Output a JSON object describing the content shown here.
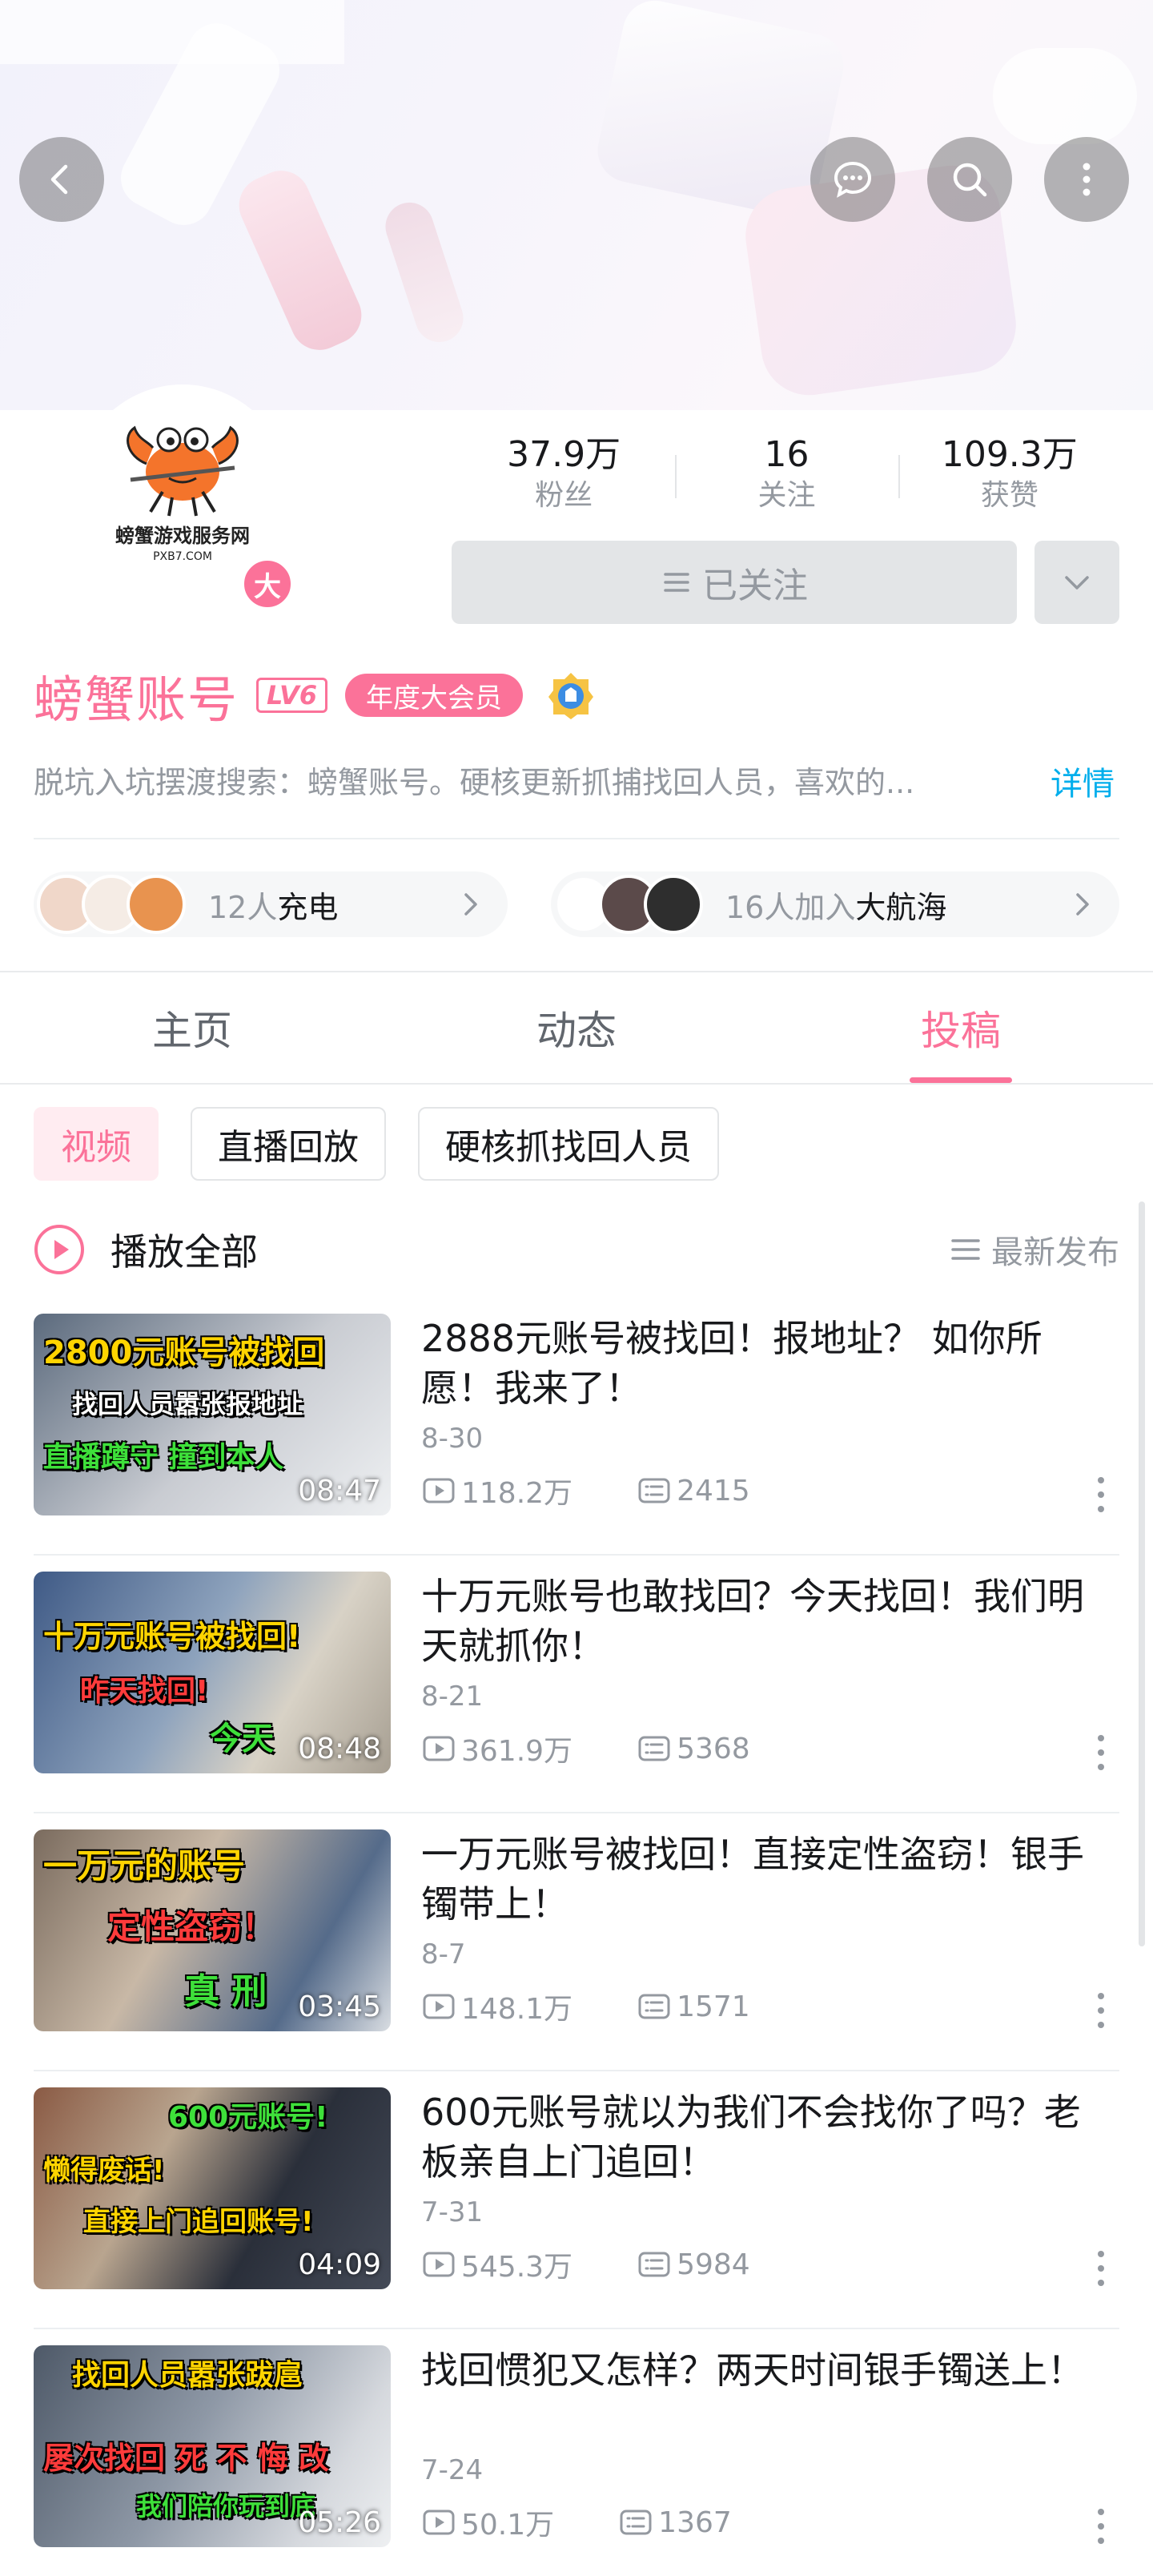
{
  "header": {
    "icons": [
      "back-icon",
      "message-icon",
      "search-icon",
      "more-vertical-icon"
    ]
  },
  "profile": {
    "avatar_text": "螃蟹游戏服务网",
    "avatar_sub": "PXB7.COM",
    "badge": "大",
    "stats": [
      {
        "num": "37.9万",
        "label": "粉丝"
      },
      {
        "num": "16",
        "label": "关注"
      },
      {
        "num": "109.3万",
        "label": "获赞"
      }
    ],
    "follow_label": "已关注",
    "username": "螃蟹账号",
    "level": "LV6",
    "vip_label": "年度大会员",
    "bio": "脱坑入坑摆渡搜索：螃蟹账号。硬核更新抓捕找回人员，喜欢的...",
    "bio_more": "详情"
  },
  "pills": {
    "charge_count": "12人",
    "charge_label": "充电",
    "voyage_count": "16人加入",
    "voyage_label": "大航海"
  },
  "tabs": [
    {
      "label": "主页"
    },
    {
      "label": "动态"
    },
    {
      "label": "投稿",
      "active": true
    }
  ],
  "chips": [
    {
      "label": "视频",
      "active": true
    },
    {
      "label": "直播回放"
    },
    {
      "label": "硬核抓找回人员"
    }
  ],
  "list_header": {
    "play_all": "播放全部",
    "sort": "最新发布"
  },
  "videos": [
    {
      "title": "2888元账号被找回！报地址？ 如你所愿！我来了！",
      "date": "8-30",
      "views": "118.2万",
      "comments": "2415",
      "duration": "08:47",
      "captions": [
        "2800元账号被找回",
        "找回人员嚣张报地址",
        "直播蹲守 撞到本人"
      ]
    },
    {
      "title": "十万元账号也敢找回？今天找回！我们明天就抓你！",
      "date": "8-21",
      "views": "361.9万",
      "comments": "5368",
      "duration": "08:48",
      "captions": [
        "十万元账号被找回!",
        "昨天找回!",
        "今天"
      ]
    },
    {
      "title": "一万元账号被找回！直接定性盗窃！银手镯带上！",
      "date": "8-7",
      "views": "148.1万",
      "comments": "1571",
      "duration": "03:45",
      "captions": [
        "一万元的账号",
        "定性盗窃！",
        "真  刑"
      ]
    },
    {
      "title": "600元账号就以为我们不会找你了吗？老板亲自上门追回！",
      "date": "7-31",
      "views": "545.3万",
      "comments": "5984",
      "duration": "04:09",
      "captions": [
        "600元账号!",
        "懒得废话!",
        "直接上门追回账号!"
      ]
    },
    {
      "title": "找回惯犯又怎样？两天时间银手镯送上！",
      "date": "7-24",
      "views": "50.1万",
      "comments": "1367",
      "duration": "05:26",
      "captions": [
        "找回人员嚣张跋扈",
        "屡次找回 死 不 悔 改",
        "我们陪你玩到底"
      ]
    }
  ],
  "colors": {
    "accent": "#fb7299",
    "link": "#00aeec",
    "muted": "#9499a0",
    "text": "#18191c"
  }
}
